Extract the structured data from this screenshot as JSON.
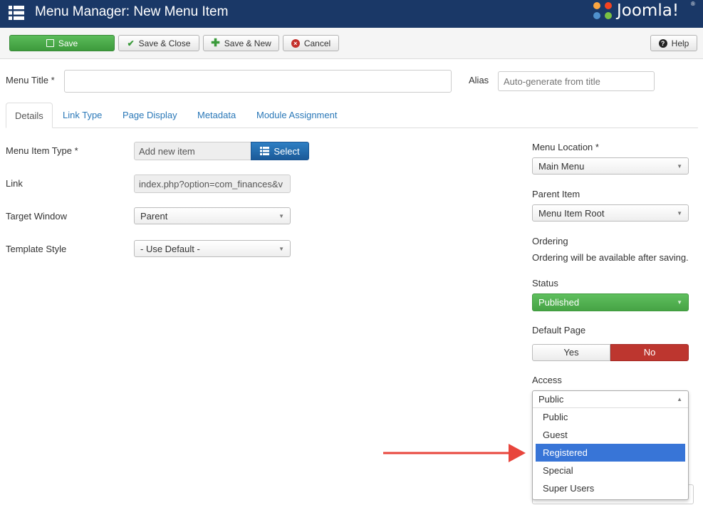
{
  "header": {
    "title": "Menu Manager: New Menu Item",
    "logo_text": "Joomla!",
    "logo_reg": "®"
  },
  "toolbar": {
    "save": "Save",
    "save_close": "Save & Close",
    "save_new": "Save & New",
    "cancel": "Cancel",
    "help": "Help"
  },
  "form": {
    "menu_title_label": "Menu Title *",
    "menu_title_value": "",
    "alias_label": "Alias",
    "alias_placeholder": "Auto-generate from title"
  },
  "tabs": [
    "Details",
    "Link Type",
    "Page Display",
    "Metadata",
    "Module Assignment"
  ],
  "details": {
    "menu_item_type_label": "Menu Item Type *",
    "menu_item_type_value": "Add new item",
    "select_button": "Select",
    "link_label": "Link",
    "link_value": "index.php?option=com_finances&v",
    "target_window_label": "Target Window",
    "target_window_value": "Parent",
    "template_style_label": "Template Style",
    "template_style_value": "- Use Default -"
  },
  "sidebar": {
    "menu_location_label": "Menu Location *",
    "menu_location_value": "Main Menu",
    "parent_item_label": "Parent Item",
    "parent_item_value": "Menu Item Root",
    "ordering_label": "Ordering",
    "ordering_note": "Ordering will be available after saving.",
    "status_label": "Status",
    "status_value": "Published",
    "default_page_label": "Default Page",
    "default_yes": "Yes",
    "default_no": "No",
    "access_label": "Access",
    "access_value": "Public",
    "access_options": [
      "Public",
      "Guest",
      "Registered",
      "Special",
      "Super Users"
    ],
    "access_highlighted": "Registered"
  },
  "colors": {
    "header_bg": "#1a3867",
    "save_green": "#46a345",
    "no_red": "#bd362f",
    "select_blue": "#1b5a98",
    "highlight_blue": "#3875d7",
    "arrow_red": "#e8453c"
  }
}
